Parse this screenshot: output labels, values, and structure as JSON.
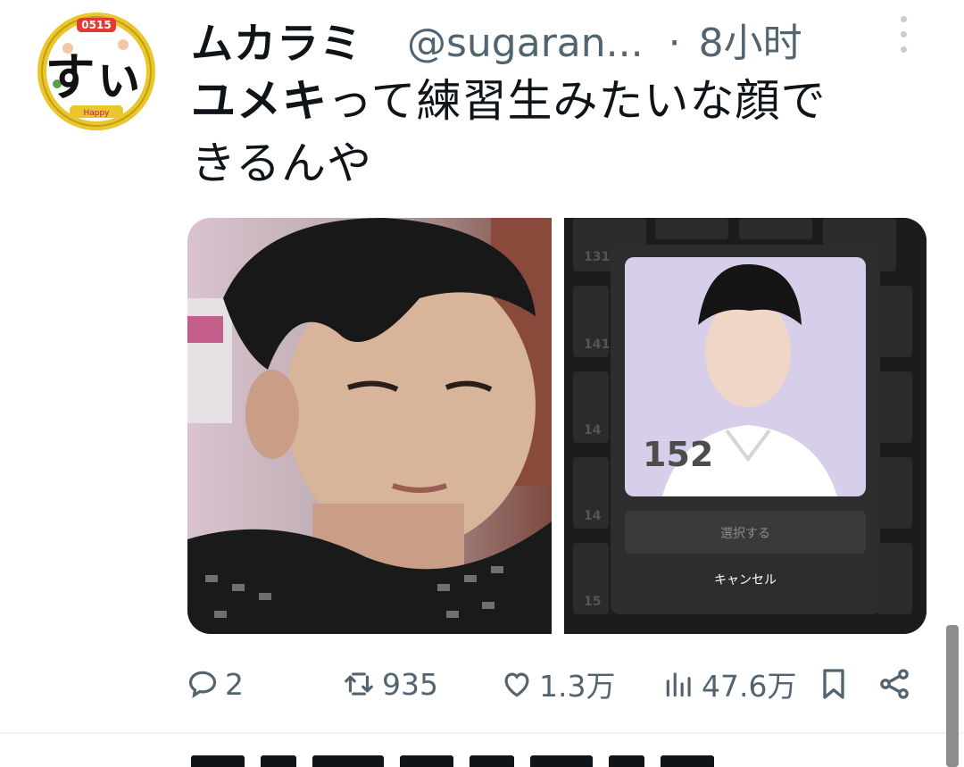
{
  "author": {
    "display_name": "ムカラミ",
    "handle": "@sugaran...",
    "separator": "·",
    "time": "8小时",
    "avatar_badge": "0515",
    "avatar_glyph": "すぃ"
  },
  "tweet": {
    "text_bold": "ユメキ",
    "text_rest": "って練習生みたいな顔で",
    "text_line2": "きるんや"
  },
  "media": {
    "right_panel": {
      "number": "152",
      "select_button": "選択する",
      "cancel_button": "キャンセル",
      "grid_numbers": [
        "131",
        "141",
        "14",
        "14",
        "15"
      ]
    }
  },
  "actions": {
    "replies": "2",
    "retweets": "935",
    "likes": "1.3万",
    "views": "47.6万"
  },
  "icons": {
    "reply": "reply-icon",
    "retweet": "retweet-icon",
    "like": "heart-icon",
    "views": "views-icon",
    "bookmark": "bookmark-icon",
    "share": "share-icon",
    "more": "more-dots-icon"
  },
  "colors": {
    "text": "#0f1419",
    "muted": "#536471",
    "avatar_ring": "#e9c62b",
    "card_bg": "#d7ceea"
  }
}
